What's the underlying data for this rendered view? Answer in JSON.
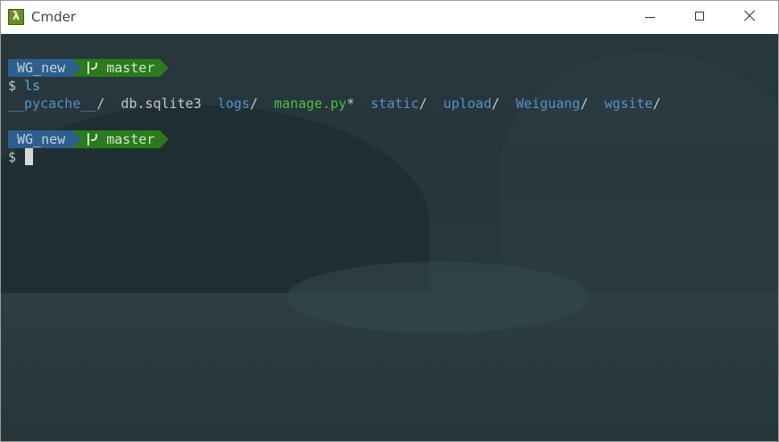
{
  "window": {
    "title": "Cmder",
    "app_icon_glyph": "λ",
    "controls": [
      "minimize-icon",
      "maximize-icon",
      "close-icon"
    ]
  },
  "terminal": {
    "prompt1": {
      "dir": "WG_new",
      "branch": "master"
    },
    "command1": {
      "symbol": "$",
      "text": "ls"
    },
    "ls_output": [
      {
        "name": "__pycache__",
        "suffix": "/",
        "type": "dir"
      },
      {
        "name": "db.sqlite3",
        "suffix": "",
        "type": "file"
      },
      {
        "name": "logs",
        "suffix": "/",
        "type": "dir"
      },
      {
        "name": "manage.py",
        "suffix": "*",
        "type": "exec"
      },
      {
        "name": "static",
        "suffix": "/",
        "type": "dir"
      },
      {
        "name": "upload",
        "suffix": "/",
        "type": "dir"
      },
      {
        "name": "Weiguang",
        "suffix": "/",
        "type": "dir"
      },
      {
        "name": "wgsite",
        "suffix": "/",
        "type": "dir"
      }
    ],
    "prompt2": {
      "dir": "WG_new",
      "branch": "master"
    },
    "command2": {
      "symbol": "$",
      "text": ""
    }
  },
  "colors": {
    "dir_segment": "#2e5e8c",
    "git_segment": "#2a7a1e",
    "directory_text": "#5a8fc8",
    "executable_text": "#4fbf3a"
  }
}
